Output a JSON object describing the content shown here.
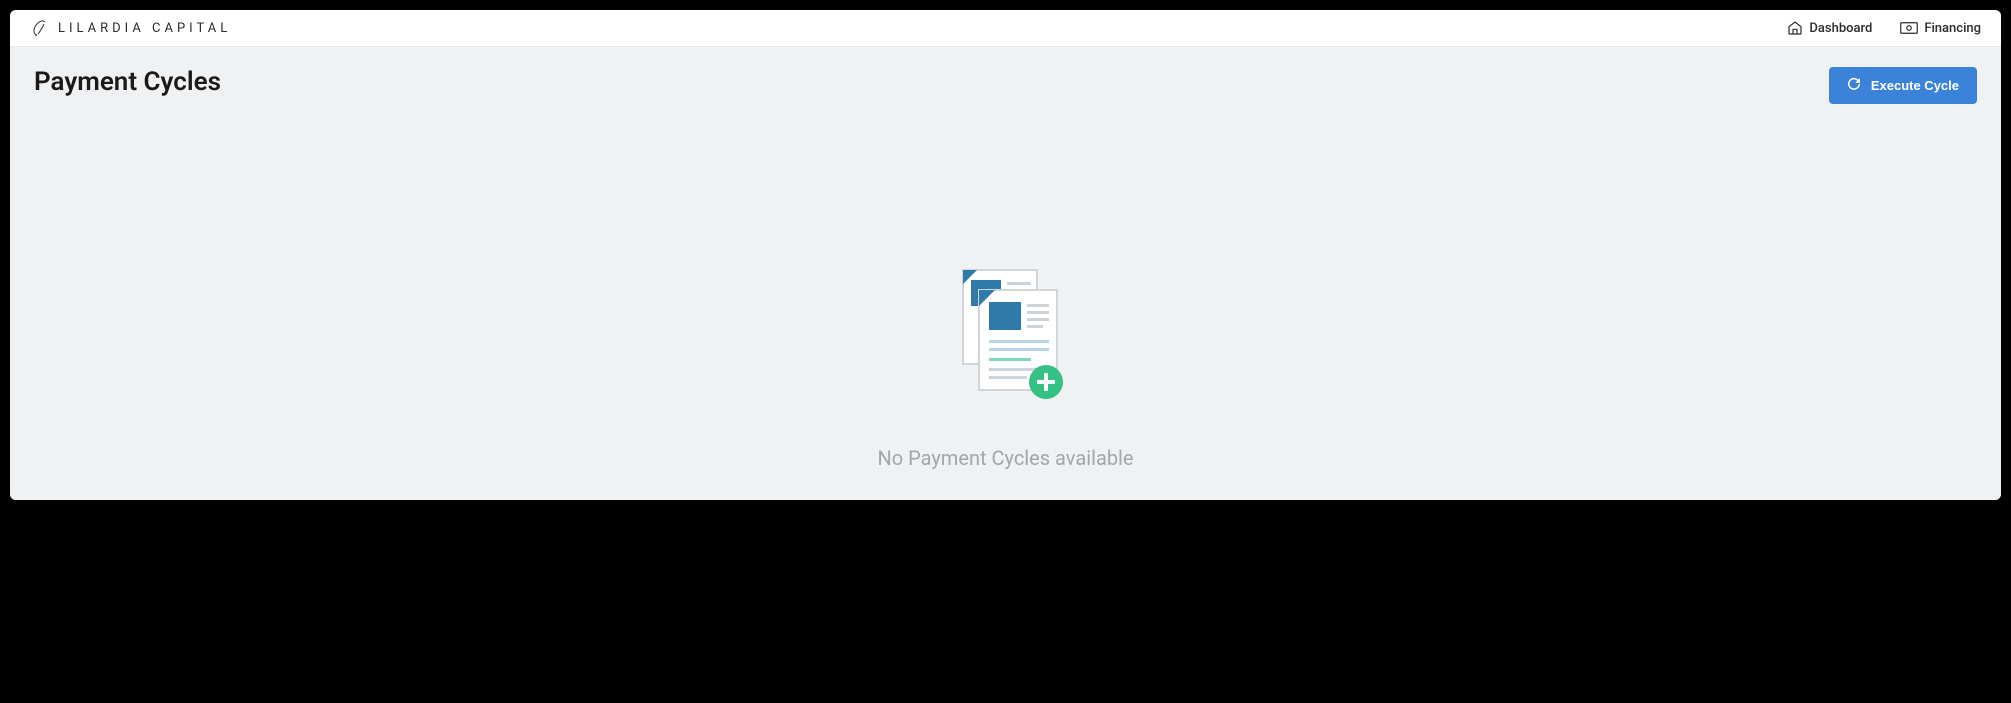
{
  "brand": {
    "name": "LILARDIA CAPITAL"
  },
  "nav": {
    "dashboard": "Dashboard",
    "financing": "Financing"
  },
  "page": {
    "title": "Payment Cycles"
  },
  "actions": {
    "execute_cycle": "Execute Cycle"
  },
  "empty_state": {
    "message": "No Payment Cycles available"
  }
}
